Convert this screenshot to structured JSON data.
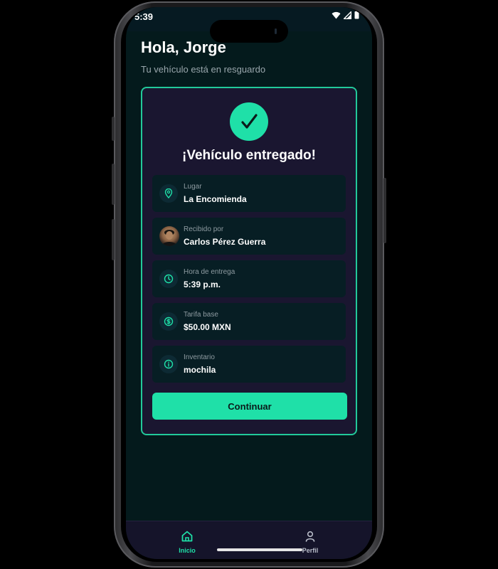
{
  "status_bar": {
    "time": "5:39"
  },
  "header": {
    "greeting": "Hola, Jorge",
    "subtitle": "Tu vehículo está en resguardo"
  },
  "card": {
    "title": "¡Vehículo entregado!",
    "check_icon": "check-icon",
    "rows": [
      {
        "label": "Lugar",
        "value": "La Encomienda",
        "icon": "location-pin-icon"
      },
      {
        "label": "Recibido por",
        "value": "Carlos Pérez Guerra",
        "icon": "avatar"
      },
      {
        "label": "Hora de entrega",
        "value": "5:39 p.m.",
        "icon": "clock-icon"
      },
      {
        "label": "Tarifa base",
        "value": "$50.00 MXN",
        "icon": "dollar-icon"
      },
      {
        "label": "Inventario",
        "value": "mochila",
        "icon": "info-icon"
      }
    ],
    "continue_label": "Continuar"
  },
  "bottom_nav": {
    "items": [
      {
        "label": "Inicio",
        "icon": "home-icon",
        "active": true
      },
      {
        "label": "Perfil",
        "icon": "user-icon",
        "active": false
      }
    ]
  },
  "colors": {
    "accent": "#1fe0a8",
    "card_border": "#22c99a",
    "card_bg": "#1a1630",
    "row_bg": "#071e24",
    "screen_bg": "#041a1c",
    "nav_bg": "#15142a",
    "nav_inactive": "#b8bcc8"
  }
}
